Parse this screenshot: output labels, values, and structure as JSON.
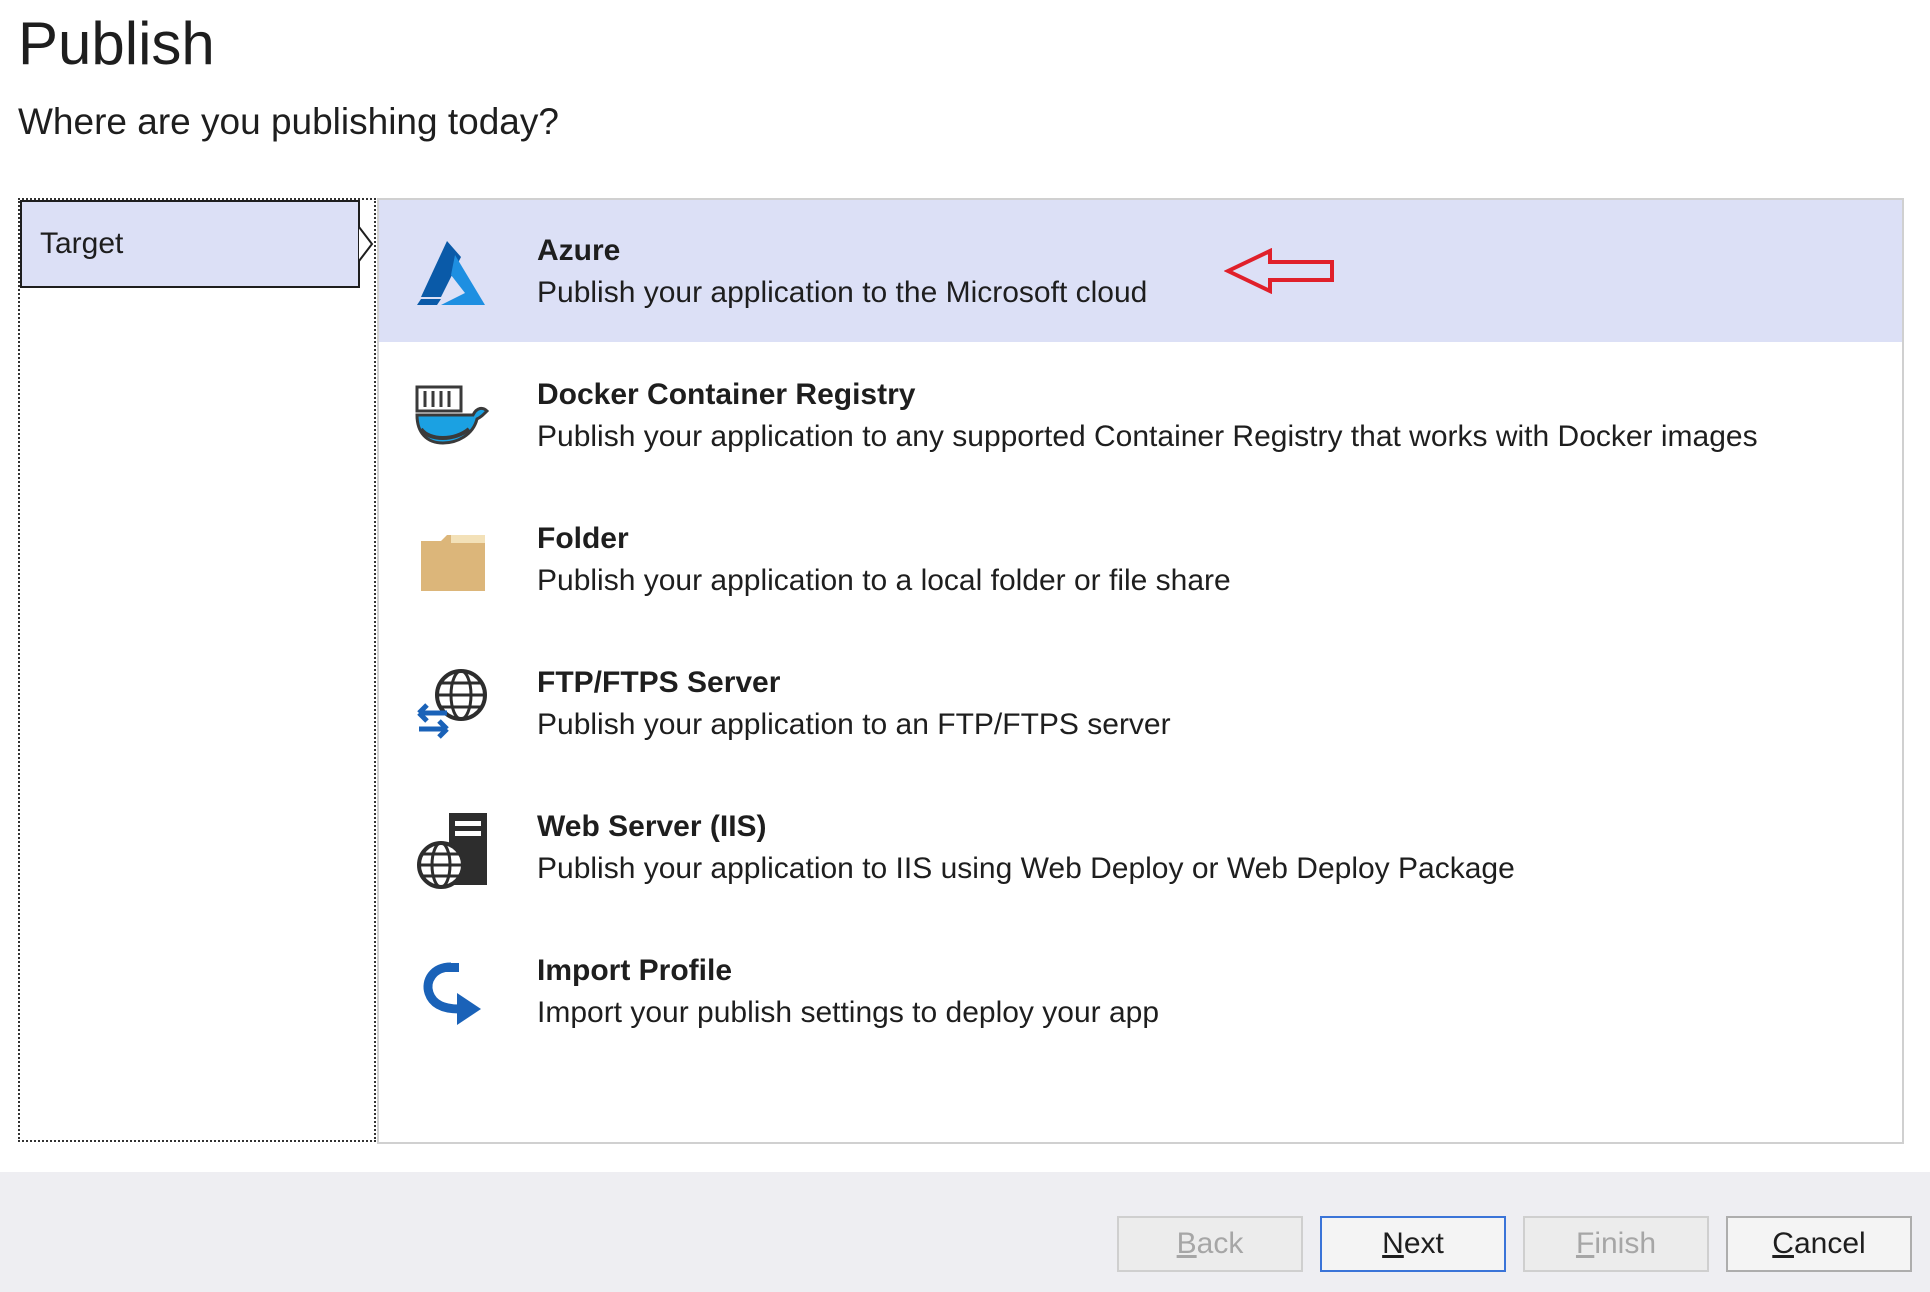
{
  "header": {
    "title": "Publish",
    "subtitle": "Where are you publishing today?"
  },
  "steps": [
    {
      "label": "Target",
      "selected": true
    }
  ],
  "options": [
    {
      "title": "Azure",
      "description": "Publish your application to the Microsoft cloud",
      "icon": "azure-icon",
      "selected": true
    },
    {
      "title": "Docker Container Registry",
      "description": "Publish your application to any supported Container Registry that works with Docker images",
      "icon": "docker-icon",
      "selected": false
    },
    {
      "title": "Folder",
      "description": "Publish your application to a local folder or file share",
      "icon": "folder-icon",
      "selected": false
    },
    {
      "title": "FTP/FTPS Server",
      "description": "Publish your application to an FTP/FTPS server",
      "icon": "ftp-globe-icon",
      "selected": false
    },
    {
      "title": "Web Server (IIS)",
      "description": "Publish your application to IIS using Web Deploy or Web Deploy Package",
      "icon": "web-server-icon",
      "selected": false
    },
    {
      "title": "Import Profile",
      "description": "Import your publish settings to deploy your app",
      "icon": "import-arrow-icon",
      "selected": false
    }
  ],
  "footer": {
    "back": {
      "mnemonic": "B",
      "rest": "ack",
      "enabled": false
    },
    "next": {
      "mnemonic": "N",
      "rest": "ext",
      "enabled": true
    },
    "finish": {
      "mnemonic": "F",
      "rest": "inish",
      "enabled": false
    },
    "cancel": {
      "mnemonic": "C",
      "rest": "ancel",
      "enabled": true
    }
  },
  "colors": {
    "selection": "#dce0f6",
    "accent_blue": "#0078d4",
    "annotation_red": "#e0202a",
    "folder": "#dcb67a",
    "footer_bg": "#eeeef2"
  }
}
